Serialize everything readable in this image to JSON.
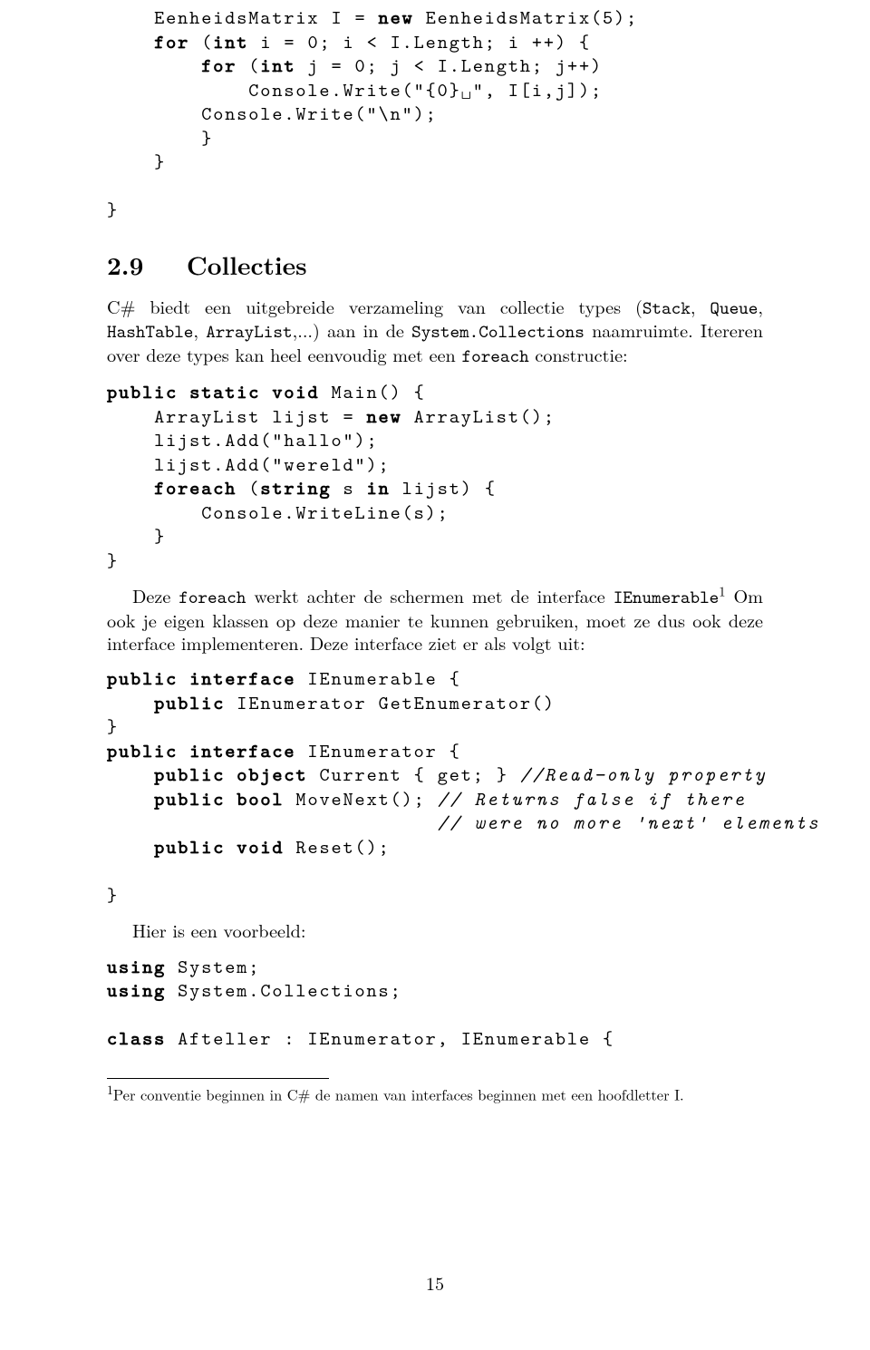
{
  "code_top": "    EenheidsMatrix I = <kw>new</kw> EenheidsMatrix(5);\n    <kw>for</kw> (<kw>int</kw> i = 0; i < I.Length; i ++) {\n        <kw>for</kw> (<kw>int</kw> j = 0; j < I.Length; j++)\n            Console.Write(\"{0}␣\", I[i,j]);\n        Console.Write(\"\\n\");\n        }\n    }\n\n}",
  "section": {
    "number": "2.9",
    "title": "Collecties"
  },
  "para1_a": "C# biedt een uitgebreide verzameling van collectie types (",
  "para1_tt1": "Stack",
  "para1_b": ", ",
  "para1_tt2": "Queue",
  "para1_c": ", ",
  "para1_tt3": "HashTable",
  "para1_d": ", ",
  "para1_tt4": "ArrayList",
  "para1_e": ",...) aan in de ",
  "para1_tt5": "System.Collections",
  "para1_f": " naamruimte. Itereren over deze types kan heel eenvoudig met een ",
  "para1_tt6": "foreach",
  "para1_g": " constructie:",
  "code_mid": "<kw>public</kw> <kw>static</kw> <kw>void</kw> Main() {\n    ArrayList lijst = <kw>new</kw> ArrayList();\n    lijst.Add(\"hallo\");\n    lijst.Add(\"wereld\");\n    <kw>foreach</kw> (<kw>string</kw> s <kw>in</kw> lijst) {\n        Console.WriteLine(s);\n    }\n}",
  "para2_a": "Deze ",
  "para2_tt1": "foreach",
  "para2_b": " werkt achter de schermen met de interface ",
  "para2_tt2": "IEnumerable",
  "para2_fn": "1",
  "para2_c": " Om ook je eigen klassen op deze manier te kunnen gebruiken, moet ze dus ook deze interface implementeren. Deze interface ziet er als volgt uit:",
  "code_iface": "<kw>public</kw> <kw>interface</kw> IEnumerable {\n    <kw>public</kw> IEnumerator GetEnumerator()\n}\n<kw>public</kw> <kw>interface</kw> IEnumerator {\n    <kw>public</kw> <kw>object</kw> Current { get; } <it>//Read−only property</it>\n    <kw>public</kw> <kw>bool</kw> MoveNext(); <it>// Returns false if there</it>\n                            <it>// were no more 'next' elements</it>\n    <kw>public</kw> <kw>void</kw> Reset();\n\n}",
  "para3": "Hier is een voorbeeld:",
  "code_bottom": "<kw>using</kw> System;\n<kw>using</kw> System.Collections;\n\n<kw>class</kw> Afteller : IEnumerator, IEnumerable {",
  "footnote_num": "1",
  "footnote_text": "Per conventie beginnen in C# de namen van interfaces beginnen met een hoofdletter I.",
  "pagenum": "15"
}
